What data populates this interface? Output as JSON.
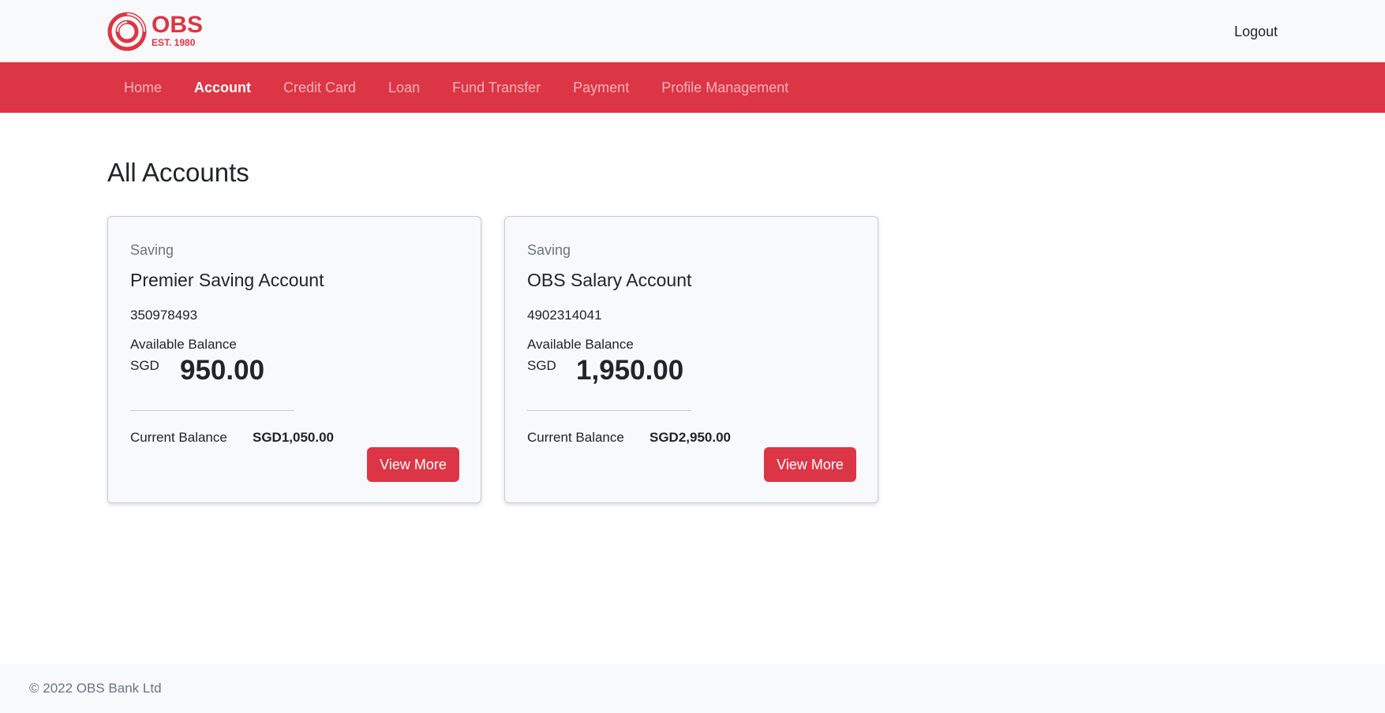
{
  "brand": {
    "name": "OBS",
    "est": "EST. 1980",
    "color": "#dc3545"
  },
  "header": {
    "logout_label": "Logout"
  },
  "nav": {
    "items": [
      {
        "label": "Home",
        "active": false
      },
      {
        "label": "Account",
        "active": true
      },
      {
        "label": "Credit Card",
        "active": false
      },
      {
        "label": "Loan",
        "active": false
      },
      {
        "label": "Fund Transfer",
        "active": false
      },
      {
        "label": "Payment",
        "active": false
      },
      {
        "label": "Profile Management",
        "active": false
      }
    ]
  },
  "main": {
    "title": "All Accounts",
    "accounts": [
      {
        "type": "Saving",
        "name": "Premier Saving Account",
        "number": "350978493",
        "available_label": "Available Balance",
        "currency": "SGD",
        "available_amount": "950.00",
        "current_label": "Current Balance",
        "current_amount": "SGD1,050.00",
        "button_label": "View More"
      },
      {
        "type": "Saving",
        "name": "OBS Salary Account",
        "number": "4902314041",
        "available_label": "Available Balance",
        "currency": "SGD",
        "available_amount": "1,950.00",
        "current_label": "Current Balance",
        "current_amount": "SGD2,950.00",
        "button_label": "View More"
      }
    ]
  },
  "footer": {
    "copyright": "© 2022 OBS Bank Ltd"
  }
}
